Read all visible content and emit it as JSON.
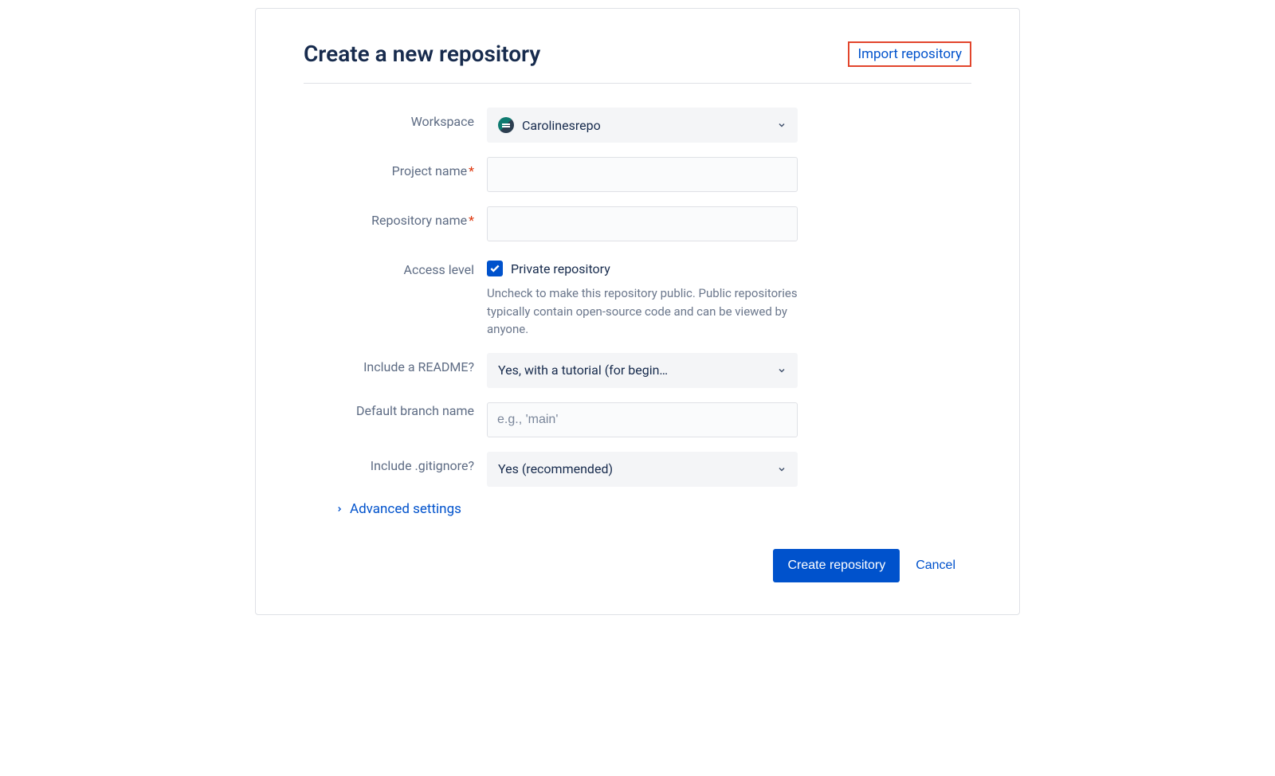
{
  "header": {
    "title": "Create a new repository",
    "import_link": "Import repository"
  },
  "form": {
    "workspace": {
      "label": "Workspace",
      "value": "Carolinesrepo"
    },
    "project_name": {
      "label": "Project name",
      "value": ""
    },
    "repository_name": {
      "label": "Repository name",
      "value": ""
    },
    "access_level": {
      "label": "Access level",
      "checkbox_label": "Private repository",
      "checked": true,
      "helper": "Uncheck to make this repository public. Public repositories typically contain open-source code and can be viewed by anyone."
    },
    "include_readme": {
      "label": "Include a README?",
      "value": "Yes, with a tutorial (for begin…"
    },
    "default_branch": {
      "label": "Default branch name",
      "placeholder": "e.g., 'main'",
      "value": ""
    },
    "include_gitignore": {
      "label": "Include .gitignore?",
      "value": "Yes (recommended)"
    },
    "advanced": "Advanced settings"
  },
  "footer": {
    "create": "Create repository",
    "cancel": "Cancel"
  }
}
